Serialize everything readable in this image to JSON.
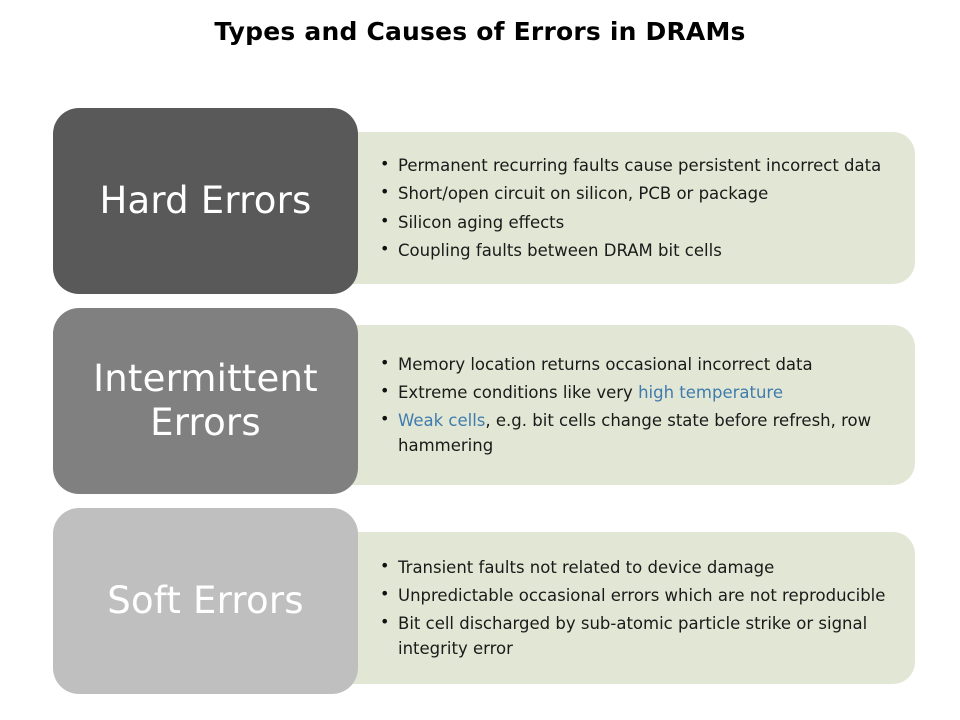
{
  "slide": {
    "title": "Types and Causes of Errors in DRAMs",
    "accent_blue": "#3F7CAD",
    "panel_bg": "#E2E6D4",
    "sections": [
      {
        "label": "Hard Errors",
        "box_color": "#595959",
        "bullets": [
          {
            "pre": "Permanent recurring faults cause persistent incorrect data",
            "hl": "",
            "post": ""
          },
          {
            "pre": "Short/open circuit on silicon, PCB or package",
            "hl": "",
            "post": ""
          },
          {
            "pre": "Silicon aging effects",
            "hl": "",
            "post": ""
          },
          {
            "pre": "Coupling faults between DRAM bit cells",
            "hl": "",
            "post": ""
          }
        ]
      },
      {
        "label": "Intermittent Errors",
        "box_color": "#808080",
        "bullets": [
          {
            "pre": "Memory location returns occasional incorrect data",
            "hl": "",
            "post": ""
          },
          {
            "pre": "Extreme conditions like very ",
            "hl": "high temperature",
            "post": ""
          },
          {
            "pre": " ",
            "hl": "Weak cells",
            "post": ", e.g. bit cells change state before refresh, row hammering"
          }
        ]
      },
      {
        "label": "Soft Errors",
        "box_color": "#BFBFBF",
        "bullets": [
          {
            "pre": "Transient faults not related to device damage",
            "hl": "",
            "post": ""
          },
          {
            "pre": "Unpredictable occasional errors which are not reproducible",
            "hl": "",
            "post": ""
          },
          {
            "pre": "Bit cell discharged by sub-atomic particle strike or signal integrity error",
            "hl": "",
            "post": ""
          }
        ]
      }
    ]
  }
}
